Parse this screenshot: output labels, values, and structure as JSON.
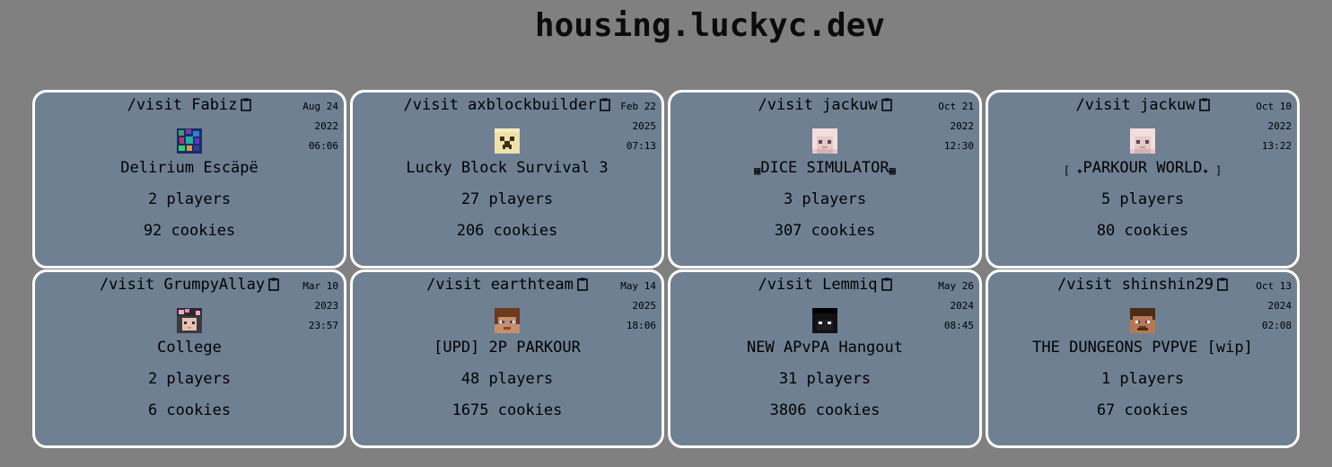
{
  "site": {
    "title": "housing.luckyc.dev"
  },
  "cards": [
    {
      "visit": "/visit Fabiz",
      "date": [
        "Aug 24",
        "2022",
        "06:06"
      ],
      "name": "Delirium Escäpë",
      "name_pre": "",
      "name_post": "",
      "players": "2 players",
      "cookies": "92 cookies",
      "head": "galaxy-head-icon"
    },
    {
      "visit": "/visit axblockbuilder",
      "date": [
        "Feb 22",
        "2025",
        "07:13"
      ],
      "name": "Lucky Block Survival 3",
      "name_pre": "",
      "name_post": "",
      "players": "27 players",
      "cookies": "206 cookies",
      "head": "creeper-head-icon"
    },
    {
      "visit": "/visit jackuw",
      "date": [
        "Oct 21",
        "2022",
        "12:30"
      ],
      "name": "DICE SIMULATOR",
      "name_pre": "▦",
      "name_post": "▦",
      "players": "3 players",
      "cookies": "307 cookies",
      "head": "pink-hair-head-icon"
    },
    {
      "visit": "/visit jackuw",
      "date": [
        "Oct 10",
        "2022",
        "13:22"
      ],
      "name": "PARKOUR WORLD",
      "name_pre": "[ ✦",
      "name_post": "✦ ]",
      "players": "5 players",
      "cookies": "80 cookies",
      "head": "pink-hair-head-icon"
    },
    {
      "visit": "/visit GrumpyAllay",
      "date": [
        "Mar 10",
        "2023",
        "23:57"
      ],
      "name": "College",
      "name_pre": "",
      "name_post": "",
      "players": "2 players",
      "cookies": "6 cookies",
      "head": "flower-head-icon"
    },
    {
      "visit": "/visit earthteam",
      "date": [
        "May 14",
        "2025",
        "18:06"
      ],
      "name": "[UPD] 2P PARKOUR",
      "name_pre": "",
      "name_post": "",
      "players": "48 players",
      "cookies": "1675 cookies",
      "head": "brown-hair-head-icon"
    },
    {
      "visit": "/visit Lemmiq",
      "date": [
        "May 26",
        "2024",
        "08:45"
      ],
      "name": "NEW APvPA Hangout",
      "name_pre": "",
      "name_post": "",
      "players": "31 players",
      "cookies": "3806 cookies",
      "head": "black-hair-head-icon"
    },
    {
      "visit": "/visit shinshin29",
      "date": [
        "Oct 13",
        "2024",
        "02:08"
      ],
      "name": "THE DUNGEONS PVPVE [wip]",
      "name_pre": "",
      "name_post": "",
      "players": "1 players",
      "cookies": "67 cookies",
      "head": "steve-head-icon"
    }
  ]
}
